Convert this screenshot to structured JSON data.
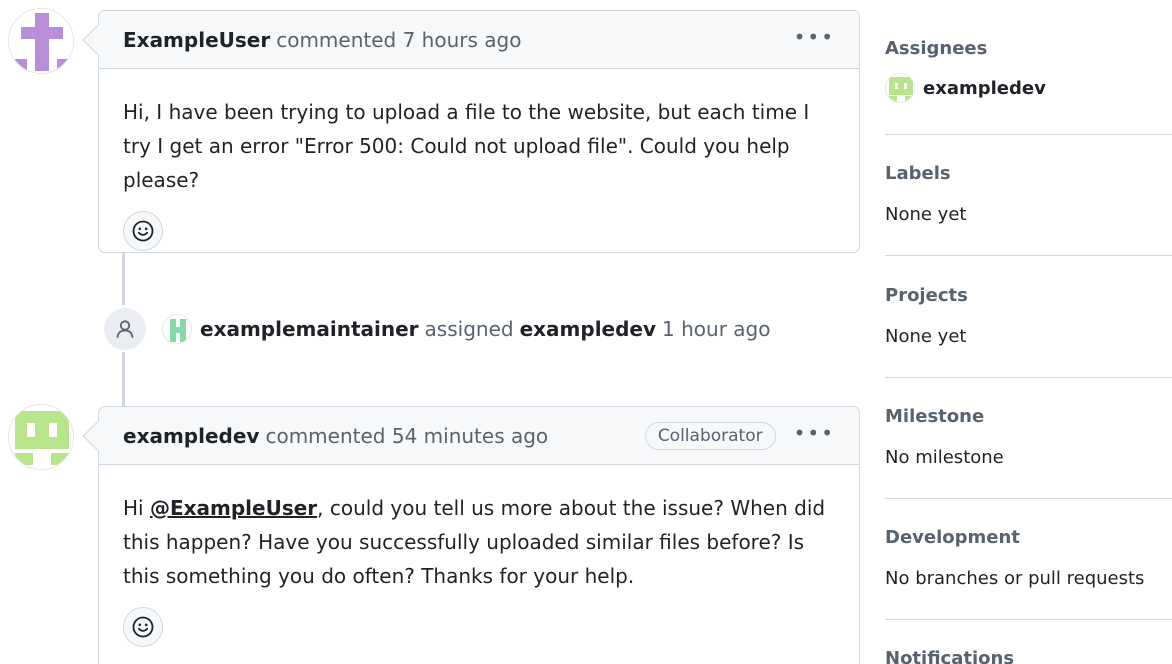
{
  "comments": [
    {
      "author": "ExampleUser",
      "meta": "commented 7 hours ago",
      "body": "Hi, I have been trying to upload a file to the website, but each time I try I get an error \"Error 500: Could not upload file\". Could you help please?",
      "avatar_color": "#b98ed9"
    },
    {
      "author": "exampledev",
      "meta": "commented 54 minutes ago",
      "badge": "Collaborator",
      "body_before": "Hi ",
      "mention": "@ExampleUser",
      "body_after": ", could you tell us more about the issue? When did this happen? Have you successfully uploaded similar files before? Is this something you do often? Thanks for your help.",
      "avatar_color": "#b8e58b"
    }
  ],
  "kebab": "•••",
  "event": {
    "actor": "examplemaintainer",
    "action": "assigned",
    "target": "exampledev",
    "time": "1 hour ago",
    "actor_avatar_color": "#86d9a8"
  },
  "sidebar": {
    "assignees": {
      "title": "Assignees",
      "user": "exampledev"
    },
    "labels": {
      "title": "Labels",
      "value": "None yet"
    },
    "projects": {
      "title": "Projects",
      "value": "None yet"
    },
    "milestone": {
      "title": "Milestone",
      "value": "No milestone"
    },
    "development": {
      "title": "Development",
      "value": "No branches or pull requests"
    },
    "notifications": {
      "title": "Notifications"
    }
  },
  "icons": {
    "reaction": "smiley-icon",
    "event": "person-icon",
    "menu": "kebab-horizontal-icon"
  },
  "colors": {
    "border": "#d0d7de",
    "header_bg": "#f6f8fa",
    "muted_text": "#59636e"
  }
}
